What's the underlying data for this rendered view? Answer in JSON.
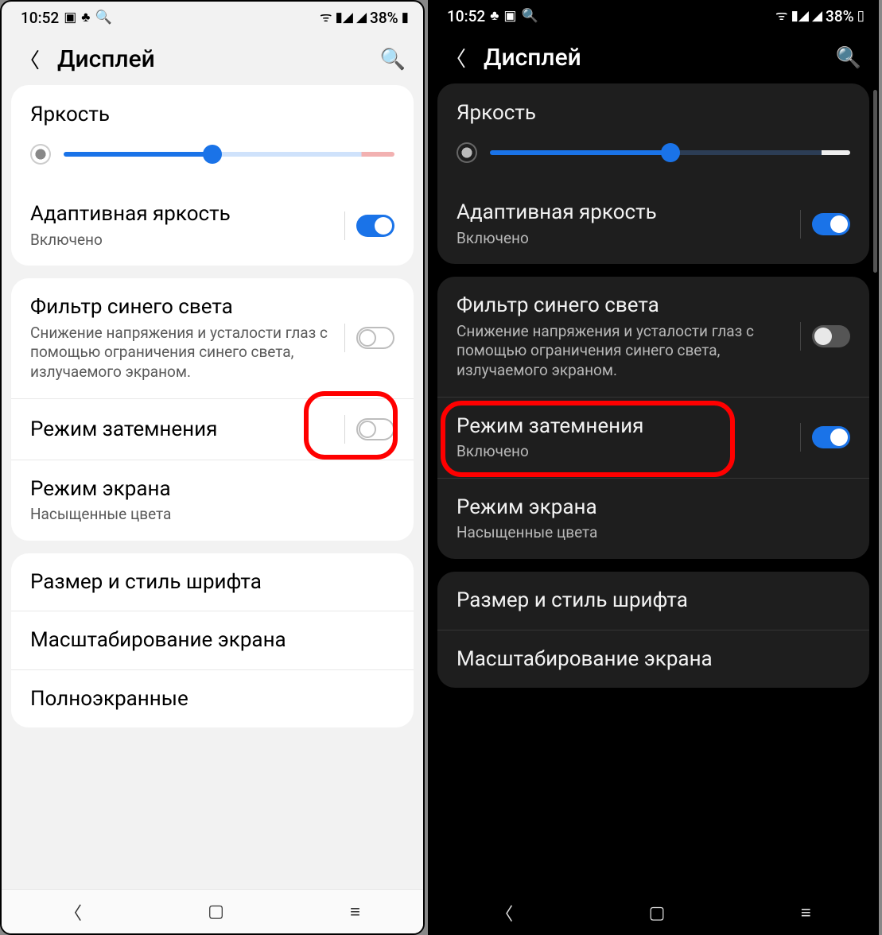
{
  "status": {
    "time": "10:52",
    "battery_pct": "38%"
  },
  "header": {
    "title": "Дисплей"
  },
  "light": {
    "brightness": {
      "title": "Яркость",
      "value_pct": 45
    },
    "adaptive": {
      "title": "Адаптивная яркость",
      "sub": "Включено",
      "on": true
    },
    "bluefilter": {
      "title": "Фильтр синего света",
      "sub": "Снижение напряжения и усталости глаз с помощью ограничения синего света, излучаемого экраном.",
      "on": false
    },
    "darkmode": {
      "title": "Режим затемнения",
      "on": false
    },
    "screenmode": {
      "title": "Режим экрана",
      "sub": "Насыщенные цвета"
    },
    "font": {
      "title": "Размер и стиль шрифта"
    },
    "zoom": {
      "title": "Масштабирование экрана"
    },
    "fullscreen": {
      "title": "Полноэкранные"
    }
  },
  "dark": {
    "brightness": {
      "title": "Яркость",
      "value_pct": 50
    },
    "adaptive": {
      "title": "Адаптивная яркость",
      "sub": "Включено",
      "on": true
    },
    "bluefilter": {
      "title": "Фильтр синего света",
      "sub": "Снижение напряжения и усталости глаз с помощью ограничения синего света, излучаемого экраном.",
      "on": false
    },
    "darkmode": {
      "title": "Режим затемнения",
      "sub": "Включено",
      "on": true
    },
    "screenmode": {
      "title": "Режим экрана",
      "sub": "Насыщенные цвета"
    },
    "font": {
      "title": "Размер и стиль шрифта"
    },
    "zoom": {
      "title": "Масштабирование экрана"
    }
  }
}
